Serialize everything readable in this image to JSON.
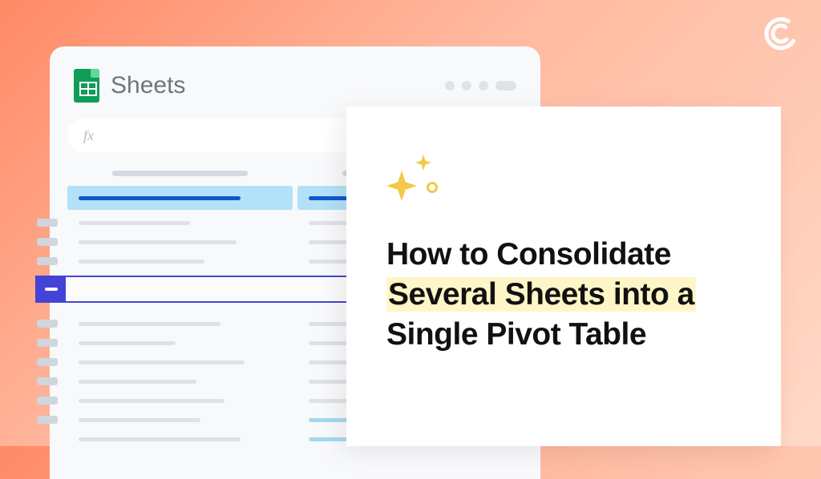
{
  "brand": {
    "logo_label": "Coefficient logo"
  },
  "sheets": {
    "app_label": "Sheets",
    "formula_prefix": "fx"
  },
  "card": {
    "headline_line1": "How to Consolidate",
    "headline_highlight": "Several Sheets into a",
    "headline_line3": "Single Pivot Table"
  },
  "colors": {
    "accent_yellow": "#f3c948",
    "highlight_bg": "#fff6c7",
    "select_blue": "#4443d8",
    "cell_highlight": "#b3e1f7"
  }
}
